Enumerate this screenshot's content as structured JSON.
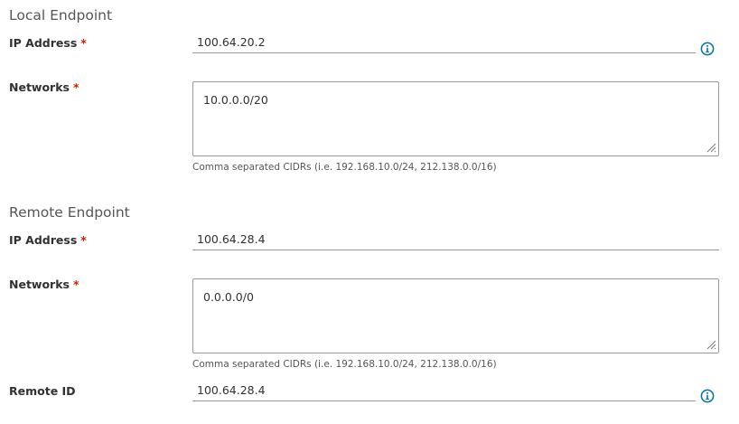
{
  "local": {
    "title": "Local Endpoint",
    "ip_label": "IP Address",
    "ip_value": "100.64.20.2",
    "networks_label": "Networks",
    "networks_value": "10.0.0.0/20",
    "helper": "Comma separated CIDRs (i.e. 192.168.10.0/24, 212.138.0.0/16)"
  },
  "remote": {
    "title": "Remote Endpoint",
    "ip_label": "IP Address",
    "ip_value": "100.64.28.4",
    "networks_label": "Networks",
    "networks_value": "0.0.0.0/0",
    "helper": "Comma separated CIDRs (i.e. 192.168.10.0/24, 212.138.0.0/16)",
    "id_label": "Remote ID",
    "id_value": "100.64.28.4"
  },
  "required_marker": "*",
  "icons": {
    "info": "info-circle-icon",
    "resize": "resize-grip-icon"
  },
  "colors": {
    "required": "#c92100",
    "info_icon": "#0072a3",
    "border": "#9a9a9a"
  }
}
